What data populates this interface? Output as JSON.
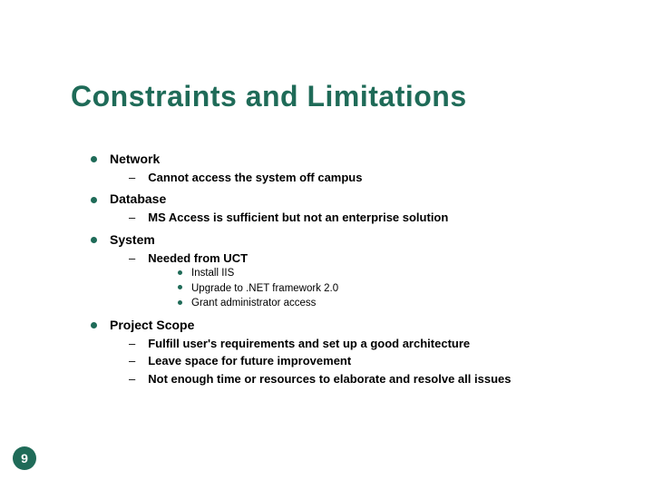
{
  "title": "Constraints and Limitations",
  "pageNumber": "9",
  "items": [
    {
      "label": "Network",
      "sub": [
        {
          "label": "Cannot access the system off campus"
        }
      ]
    },
    {
      "label": "Database",
      "sub": [
        {
          "label": "MS Access is sufficient but not an enterprise solution"
        }
      ]
    },
    {
      "label": "System",
      "sub": [
        {
          "label": "Needed from UCT",
          "sub": [
            {
              "label": "Install IIS"
            },
            {
              "label": "Upgrade to .NET framework 2.0"
            },
            {
              "label": "Grant administrator access"
            }
          ]
        }
      ]
    },
    {
      "label": "Project Scope",
      "sub": [
        {
          "label": "Fulfill user's requirements and set up a good architecture"
        },
        {
          "label": "Leave space for future improvement"
        },
        {
          "label": "Not enough time or resources to elaborate and resolve all issues"
        }
      ]
    }
  ]
}
